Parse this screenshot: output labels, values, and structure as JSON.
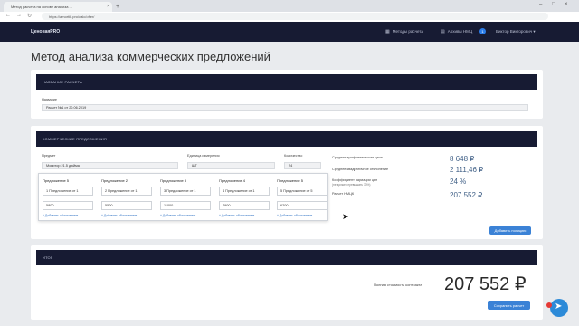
{
  "browser": {
    "tab_title": "Метод расчета на основе анализа ...",
    "url": "https://amortik.pro/calc/offer/",
    "new_tab": "+",
    "minimize": "–",
    "maximize": "□",
    "close": "×",
    "back": "←",
    "forward": "→",
    "reload": "↻"
  },
  "header": {
    "logo_main": "ЦеноваяPRO",
    "nav_methods": "Методы расчета",
    "nav_archive": "Архивы НМЦ",
    "archive_count": "1",
    "user_name": "Виктор Викторович"
  },
  "page": {
    "title": "Метод анализа коммерческих предложений"
  },
  "calc_name": {
    "header": "НАЗВАНИЕ РАСЧЕТА",
    "label": "Название",
    "value": "Расчет №1 от 20.06.2019"
  },
  "offers": {
    "header": "КОММЕРЧЕСКИЕ ПРЕДЛОЖЕНИЯ",
    "product_label": "Предмет",
    "product_value": "Монитор 21.5 дюйма",
    "unit_label": "Единица измерения",
    "unit_value": "ШТ",
    "qty_label": "Количество",
    "qty_value": "24",
    "stats": {
      "avg_label": "Средняя арифметическая цена",
      "avg_value": "8 648 ₽",
      "std_label": "Среднее квадратичное отклонение",
      "std_value": "2 111,46 ₽",
      "var_label": "Коэффициент вариации цен",
      "var_sub": "(не должен превышать 33%)",
      "var_value": "24 %",
      "nmcc_label": "Расчет НМЦК",
      "nmcc_value": "207 552 ₽"
    },
    "proposals": [
      {
        "title": "Предложение 5",
        "name": "1 Предложение от 1",
        "price": "5800",
        "add": "+ Добавить обоснование"
      },
      {
        "title": "Предложение 2",
        "name": "2 Предложение от 1",
        "price": "5500",
        "add": "+ Добавить обоснование"
      },
      {
        "title": "Предложение 3",
        "name": "3 Предложение от 1",
        "price": "11000",
        "add": "+ Добавить обоснование"
      },
      {
        "title": "Предложение 4",
        "name": "4 Предложение от 1",
        "price": "7900",
        "add": "+ Добавить обоснование"
      },
      {
        "title": "Предложение 5",
        "name": "5 Предложение от 5",
        "price": "6200",
        "add": "+ Добавить обоснование"
      }
    ],
    "add_button": "Добавить позицию"
  },
  "result": {
    "header": "ИТОГ",
    "total_label": "Полная стоимость контракта",
    "total_value": "207 552 ₽",
    "save_button": "Сохранить расчет"
  },
  "colors": {
    "header_bg": "#171b33",
    "accent": "#3b82d6",
    "stat_value": "#3f5f86",
    "page_bg": "#e9ebee"
  }
}
